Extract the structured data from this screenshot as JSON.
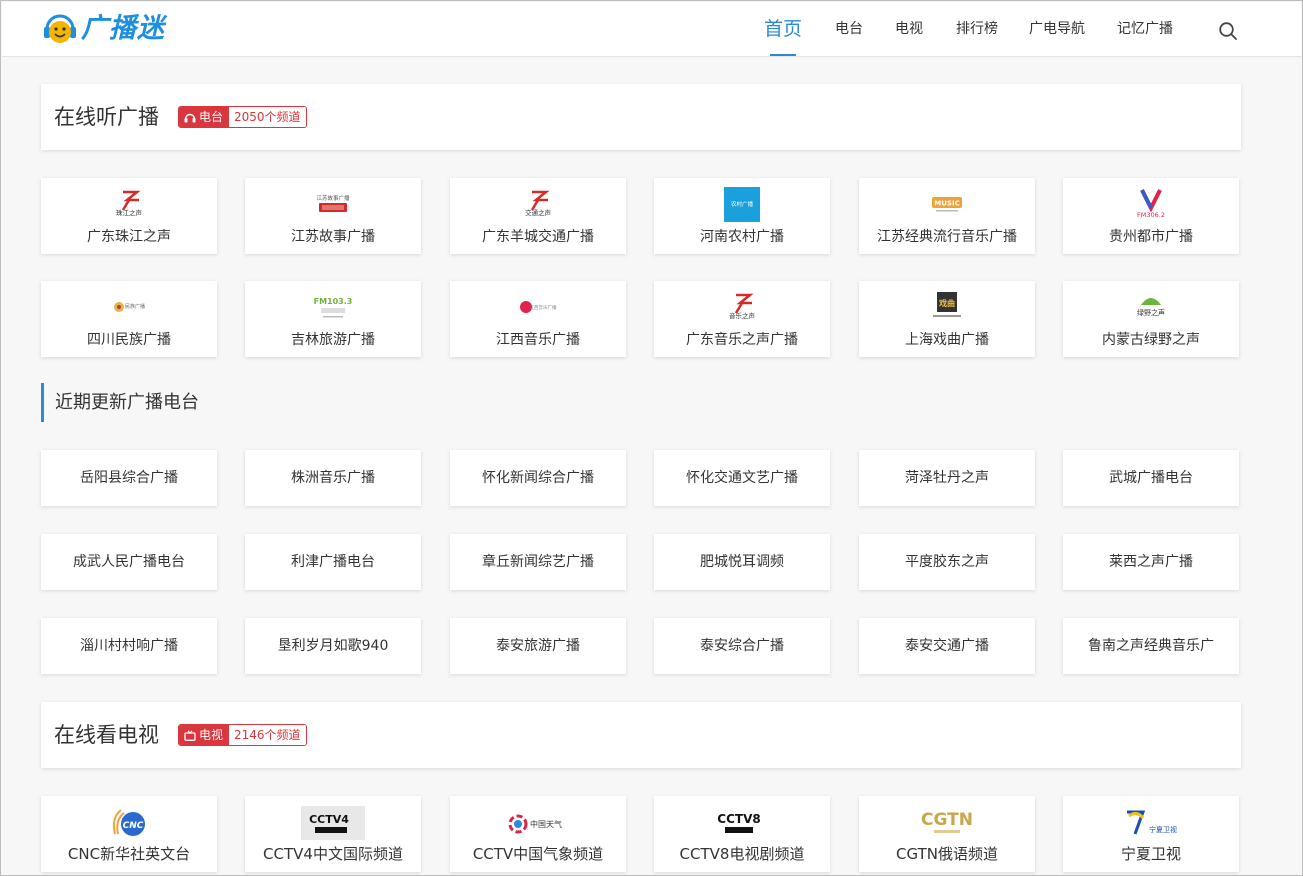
{
  "site": {
    "logo_text": "广播迷"
  },
  "nav": {
    "items": [
      {
        "label": "首页",
        "active": true
      },
      {
        "label": "电台"
      },
      {
        "label": "电视"
      },
      {
        "label": "排行榜"
      },
      {
        "label": "广电导航"
      },
      {
        "label": "记忆广播"
      }
    ]
  },
  "radio_section": {
    "title": "在线听广播",
    "badge_label": "电台",
    "badge_count": "2050个频道",
    "stations": [
      {
        "name": "广东珠江之声",
        "logo_text": "珠江之声"
      },
      {
        "name": "江苏故事广播",
        "logo_text": "江苏故事广播"
      },
      {
        "name": "广东羊城交通广播",
        "logo_text": "交通之声"
      },
      {
        "name": "河南农村广播",
        "logo_text": "农村广播"
      },
      {
        "name": "江苏经典流行音乐广播",
        "logo_text": "MUSIC"
      },
      {
        "name": "贵州都市广播",
        "logo_text": "FM306.2"
      },
      {
        "name": "四川民族广播",
        "logo_text": "民族广播"
      },
      {
        "name": "吉林旅游广播",
        "logo_text": "FM103.3"
      },
      {
        "name": "江西音乐广播",
        "logo_text": "江西音乐广播"
      },
      {
        "name": "广东音乐之声广播",
        "logo_text": "音乐之声"
      },
      {
        "name": "上海戏曲广播",
        "logo_text": "戏曲"
      },
      {
        "name": "内蒙古绿野之声",
        "logo_text": "绿野之声"
      }
    ]
  },
  "recent_section": {
    "title": "近期更新广播电台",
    "stations": [
      "岳阳县综合广播",
      "株洲音乐广播",
      "怀化新闻综合广播",
      "怀化交通文艺广播",
      "菏泽牡丹之声",
      "武城广播电台",
      "成武人民广播电台",
      "利津广播电台",
      "章丘新闻综艺广播",
      "肥城悦耳调频",
      "平度胶东之声",
      "莱西之声广播",
      "淄川村村响广播",
      "垦利岁月如歌940",
      "泰安旅游广播",
      "泰安综合广播",
      "泰安交通广播",
      "鲁南之声经典音乐广"
    ]
  },
  "tv_section": {
    "title": "在线看电视",
    "badge_label": "电视",
    "badge_count": "2146个频道",
    "channels": [
      {
        "name": "CNC新华社英文台",
        "logo_text": "CNC"
      },
      {
        "name": "CCTV4中文国际频道",
        "logo_text": "CCTV4"
      },
      {
        "name": "CCTV中国气象频道",
        "logo_text": "中国天气"
      },
      {
        "name": "CCTV8电视剧频道",
        "logo_text": "CCTV8"
      },
      {
        "name": "CGTN俄语频道",
        "logo_text": "CGTN"
      },
      {
        "name": "宁夏卫视",
        "logo_text": "宁夏卫视"
      }
    ]
  },
  "colors": {
    "accent": "#2a8ad8",
    "badge_red": "#d9363e",
    "logo_blue": "#1e8fe0",
    "logo_yellow": "#f5b400"
  }
}
